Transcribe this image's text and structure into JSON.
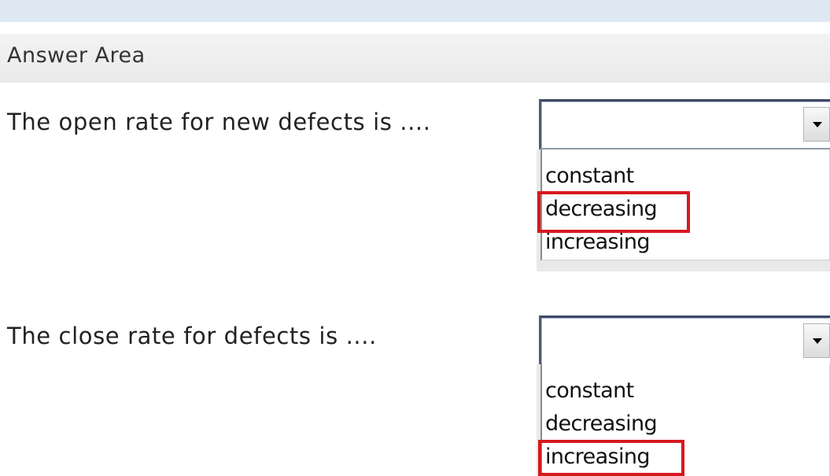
{
  "answer_area": {
    "title": "Answer Area"
  },
  "questions": [
    {
      "text": "The open rate for new defects is ....",
      "selected_value": "",
      "options": [
        "constant",
        "decreasing",
        "increasing"
      ],
      "highlighted_option": "decreasing"
    },
    {
      "text": "The close rate for defects is ....",
      "selected_value": "",
      "options": [
        "constant",
        "decreasing",
        "increasing"
      ],
      "highlighted_option": "increasing"
    }
  ],
  "icons": {
    "dropdown": "chevron-down-icon"
  },
  "colors": {
    "highlight": "#d71920",
    "top_bar": "#dfe9f4",
    "header_bg": "#efefef"
  }
}
